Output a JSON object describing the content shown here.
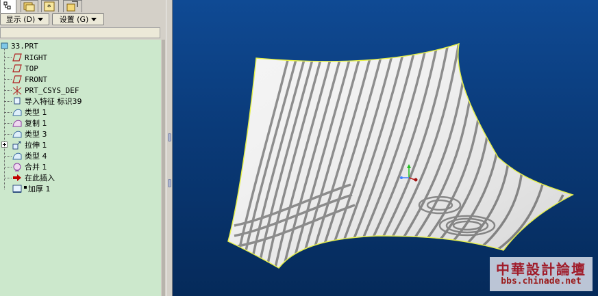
{
  "toolbar": {
    "display_label": "显示 (D)",
    "settings_label": "设置 (G)"
  },
  "tree": {
    "items": [
      {
        "label": "33.PRT",
        "icon": "part-icon"
      },
      {
        "label": "RIGHT",
        "icon": "datum-plane-icon"
      },
      {
        "label": "TOP",
        "icon": "datum-plane-icon"
      },
      {
        "label": "FRONT",
        "icon": "datum-plane-icon"
      },
      {
        "label": "PRT_CSYS_DEF",
        "icon": "csys-icon"
      },
      {
        "label": "导入特征 标识39",
        "icon": "import-feature-icon"
      },
      {
        "label": "类型 1",
        "icon": "surface-icon"
      },
      {
        "label": "复制 1",
        "icon": "copy-surface-icon"
      },
      {
        "label": "类型 3",
        "icon": "surface-icon"
      },
      {
        "label": "拉伸 1",
        "icon": "extrude-icon"
      },
      {
        "label": "类型 4",
        "icon": "surface-icon"
      },
      {
        "label": "合并 1",
        "icon": "merge-icon"
      },
      {
        "label": "在此插入",
        "icon": "insert-here-arrow-icon"
      },
      {
        "label": "加厚 1",
        "icon": "thicken-icon"
      }
    ]
  },
  "watermark": {
    "title": "中華設計論壇",
    "url": "bbs.chinade.net"
  },
  "colors": {
    "tree_bg": "#cce8cc",
    "viewport_bg": "#0a3a78",
    "surface_edge": "#e6f04a",
    "insert_arrow": "#c00000"
  }
}
